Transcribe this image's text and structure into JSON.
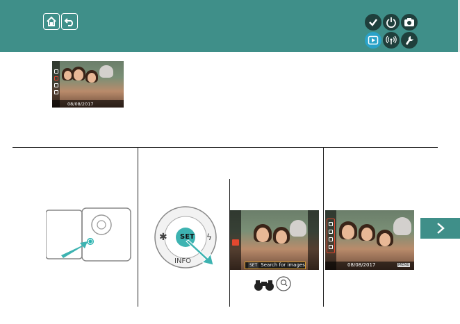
{
  "header": {
    "home_icon": "home-icon",
    "back_icon": "back-arrow-icon",
    "right_icons": [
      "check-icon",
      "power-icon",
      "camera-icon",
      "playback-icon",
      "wireless-icon",
      "wrench-icon"
    ],
    "active_icon": "playback-icon"
  },
  "thumbnail_top": {
    "date": "08/08/2017"
  },
  "step3_screen": {
    "caption_tag": "SET",
    "caption_text": "Search for images"
  },
  "step4_screen": {
    "date": "08/08/2017",
    "menu_tag": "MENU"
  },
  "step2_dial": {
    "center_label": "SET",
    "bottom_label": "INFO"
  },
  "colors": {
    "header": "#3f8f89",
    "active_icon": "#2aa2c8",
    "highlight": "#e2482f",
    "caption_border": "#d89b2c"
  }
}
